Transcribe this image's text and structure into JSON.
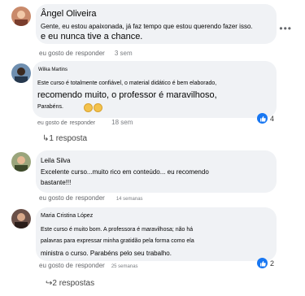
{
  "comments": [
    {
      "author": "Ângel Oliveira",
      "text_line1": "Gente, eu estou apaixonada, já faz tempo que estou querendo fazer isso.",
      "text_line2": "e eu nunca tive a chance.",
      "like_label": "eu gosto de",
      "reply_label": "responder",
      "time": "3 sem"
    },
    {
      "author": "Wilka Martins",
      "text_line1": "Este curso é totalmente confiável, o material didático é bem elaborado,",
      "text_line2": "recomendo muito, o professor é maravilhoso,",
      "text_line3": "Parabéns.",
      "like_label": "eu gosto de",
      "reply_label": "responder",
      "time": "18 sem",
      "reaction_count": "4",
      "replies_label": "1 resposta"
    },
    {
      "author": "Leila Silva",
      "text_line1": "Excelente curso...muito rico em conteúdo... eu recomendo",
      "text_line2": "bastante!!!",
      "like_label": "eu gosto de",
      "reply_label": "responder",
      "time": "14 semanas"
    },
    {
      "author": "Maria Cristina López",
      "text_line1": "Este curso é muito bom. A professora é maravilhosa; não há",
      "text_line2": "palavras para expressar minha gratidão pela forma como ela",
      "text_line3": "ministra o curso. Parabéns pelo seu trabalho.",
      "like_label": "eu gosto de",
      "reply_label": "responder",
      "time": "25 semanas",
      "reaction_count": "2",
      "replies_label": "2 respostas"
    }
  ],
  "more_options": "•••",
  "colors": {
    "like_blue": "#1877f2",
    "bubble": "#f0f2f5"
  }
}
